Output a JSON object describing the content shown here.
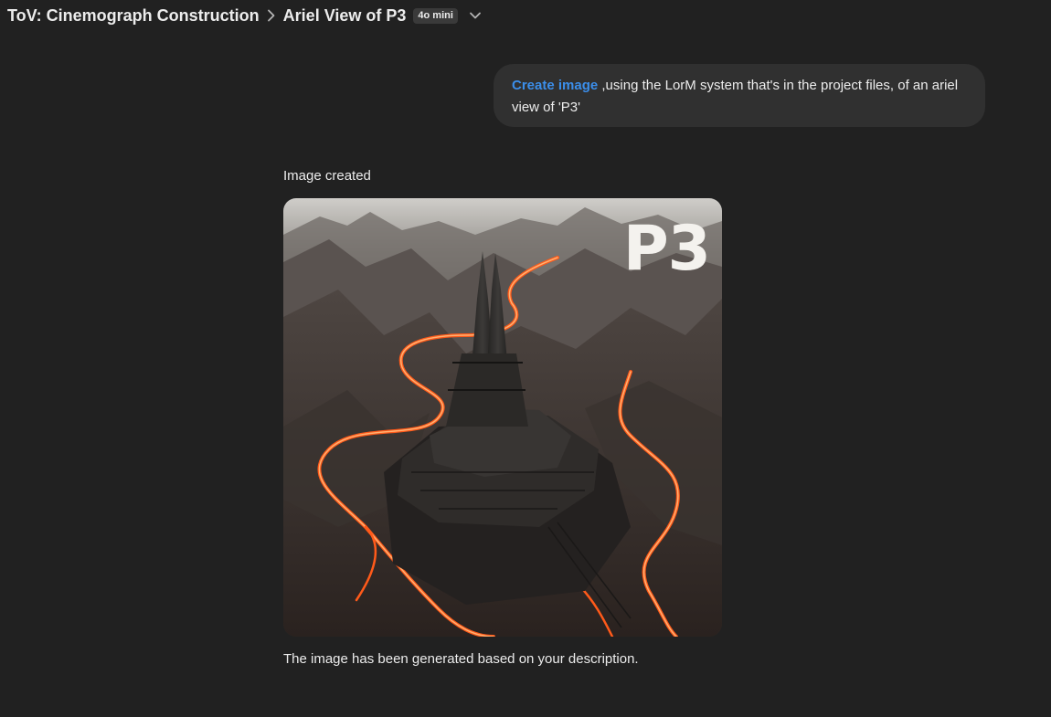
{
  "header": {
    "project": "ToV: Cinemograph Construction",
    "conversation_title": "Ariel View of P3",
    "model_badge": "4o mini"
  },
  "user_message": {
    "tool_tag": "Create image",
    "text": " ,using the LorM system that's in the project files, of an ariel view of 'P3'"
  },
  "assistant": {
    "status": "Image created",
    "image_label": "P3",
    "result_text": "The image has been generated based on your description."
  },
  "icons": {
    "breadcrumb_separator": "chevron-right-icon",
    "model_menu": "chevron-down-icon"
  },
  "colors": {
    "background": "#212121",
    "user_bubble": "#303030",
    "tool_tag": "#3b8eea",
    "lava": "#ff5a1a"
  }
}
